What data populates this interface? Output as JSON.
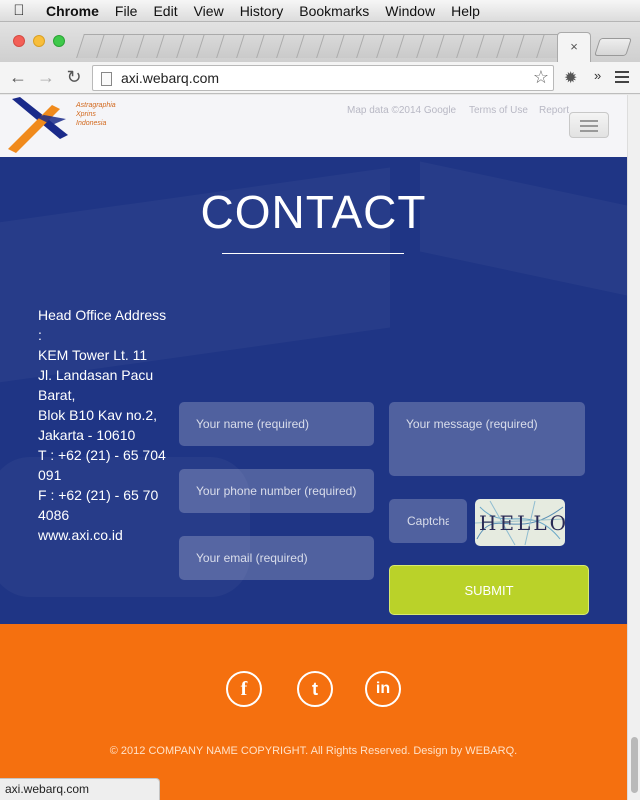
{
  "os_menubar": {
    "app_name": "Chrome",
    "items": [
      "File",
      "Edit",
      "View",
      "History",
      "Bookmarks",
      "Window",
      "Help"
    ]
  },
  "browser": {
    "active_tab_close": "×",
    "url": "axi.webarq.com",
    "more_extensions": "»",
    "status_url": "axi.webarq.com"
  },
  "header": {
    "logo_lines": [
      "Astragraphia",
      "Xprins",
      "Indonesia"
    ],
    "map_credits": [
      "Map data ©2014 Google",
      "Terms of Use",
      "Report"
    ]
  },
  "contact": {
    "title": "CONTACT",
    "address_lines": [
      "Head Office Address",
      ":",
      "KEM Tower Lt. 11",
      "Jl. Landasan Pacu",
      "Barat,",
      "Blok B10 Kav no.2,",
      "Jakarta - 10610",
      "T : +62 (21) - 65 704",
      "091",
      "F : +62 (21) - 65 70",
      "4086",
      "www.axi.co.id"
    ],
    "form": {
      "name_placeholder": "Your name (required)",
      "phone_placeholder": "Your phone number (required)",
      "email_placeholder": "Your email (required)",
      "message_placeholder": "Your message (required)",
      "captcha_placeholder": "Captcha",
      "captcha_text": "HELLO",
      "submit_label": "SUBMIT"
    }
  },
  "footer": {
    "social": [
      {
        "name": "facebook",
        "glyph": "f"
      },
      {
        "name": "twitter",
        "glyph": "t"
      },
      {
        "name": "linkedin",
        "glyph": "in"
      }
    ],
    "copyright": "© 2012 COMPANY NAME COPYRIGHT. All Rights Reserved. Design by WEBARQ."
  },
  "colors": {
    "contact_bg": "#1f3585",
    "footer_bg": "#f5700f",
    "submit_bg": "#bad229"
  }
}
